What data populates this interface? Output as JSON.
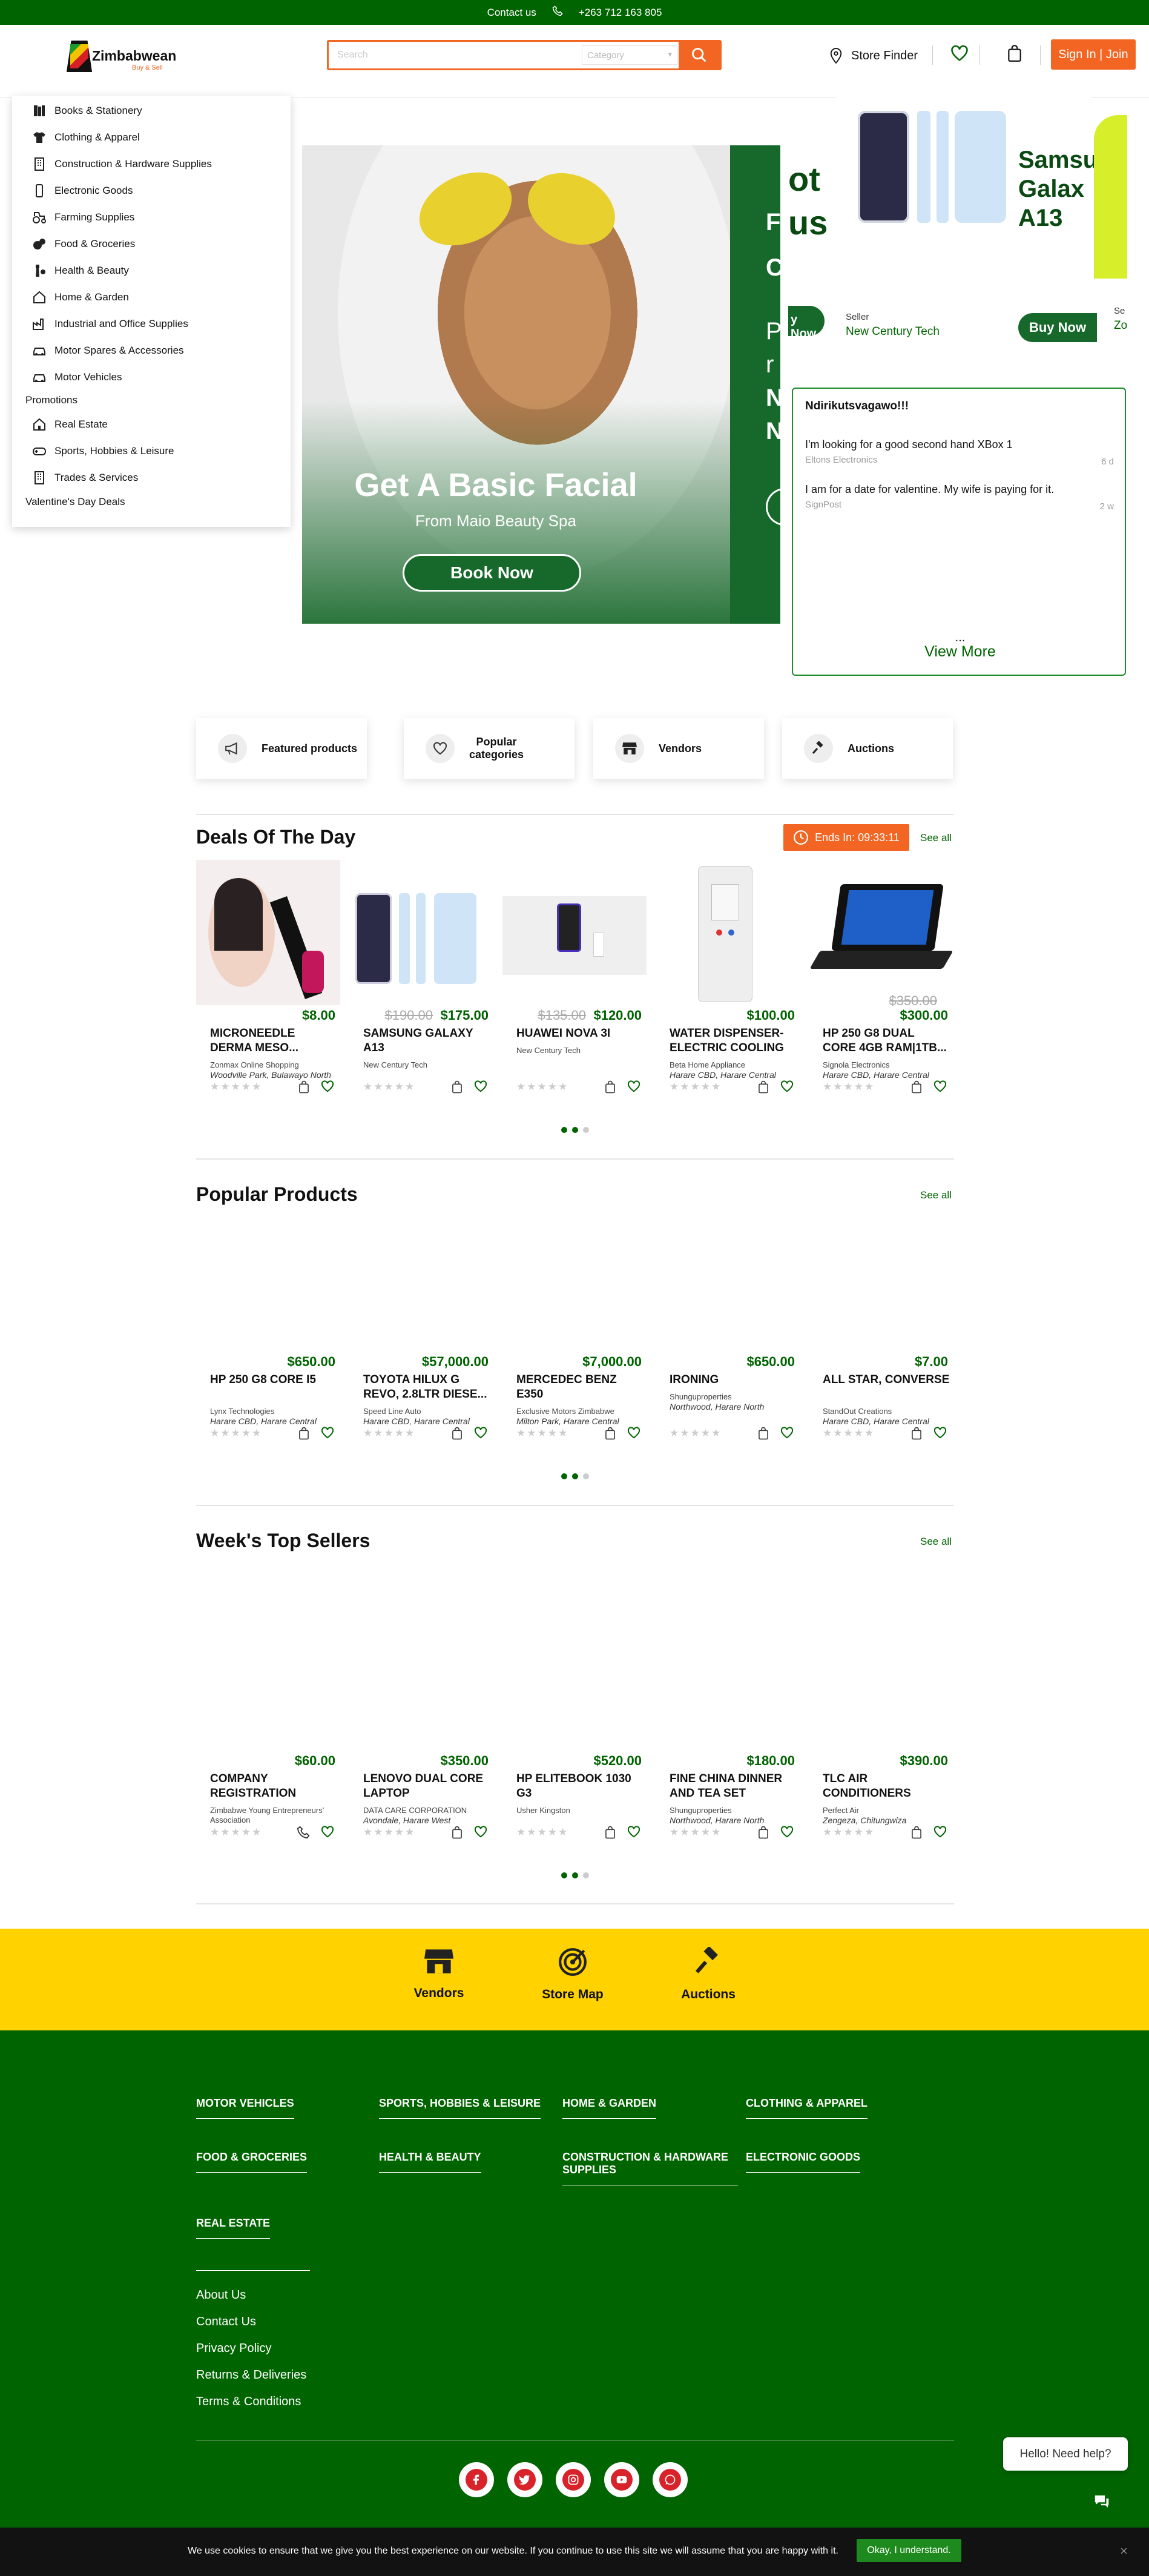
{
  "topbar": {
    "contact": "Contact us",
    "phone": "+263 712 163 805"
  },
  "header": {
    "logo_name": "Zimbabwean",
    "logo_sub": "Buy & Sell",
    "search_placeholder": "Search",
    "category_placeholder": "Category",
    "store_finder": "Store Finder",
    "signin": "Sign In | Join"
  },
  "categories": [
    {
      "label": "Books & Stationery",
      "icon": "books-icon"
    },
    {
      "label": "Clothing & Apparel",
      "icon": "shirt-icon"
    },
    {
      "label": "Construction & Hardware Supplies",
      "icon": "building-icon"
    },
    {
      "label": "Electronic Goods",
      "icon": "phone-icon"
    },
    {
      "label": "Farming Supplies",
      "icon": "tractor-icon"
    },
    {
      "label": "Food & Groceries",
      "icon": "food-icon"
    },
    {
      "label": "Health & Beauty",
      "icon": "beauty-icon"
    },
    {
      "label": "Home & Garden",
      "icon": "home-icon"
    },
    {
      "label": "Industrial and Office Supplies",
      "icon": "factory-icon"
    },
    {
      "label": "Motor Spares & Accessories",
      "icon": "car-icon"
    },
    {
      "label": "Motor Vehicles",
      "icon": "car-icon"
    }
  ],
  "categories_extra": [
    {
      "label": "Real Estate",
      "icon": "house-icon"
    },
    {
      "label": "Sports, Hobbies & Leisure",
      "icon": "gamepad-icon"
    },
    {
      "label": "Trades & Services",
      "icon": "building-icon"
    }
  ],
  "promotions_label": "Promotions",
  "valentines_label": "Valentine's Day Deals",
  "hero": {
    "title": "Get A Basic Facial",
    "subtitle": "From Maio Beauty Spa",
    "button": "Book Now",
    "peek_lines": [
      "F",
      "C",
      "P",
      "r",
      "N",
      "N"
    ]
  },
  "promo": {
    "left_peek": "ot\nus",
    "left_buy": "y Now",
    "model": "Samsu\nGalax\nA13",
    "seller_label": "Seller",
    "seller_name": "New Century Tech",
    "buy": "Buy Now",
    "right_peek_seller": "Se",
    "right_peek_name": "Zo"
  },
  "posts": {
    "user": "Ndirikutsvagawo!!!",
    "items": [
      {
        "text": "I'm looking for a good second hand XBox 1",
        "source": "Eltons Electronics",
        "age": "6 d"
      },
      {
        "text": "I am for a date for valentine. My wife is paying for it.",
        "source": "SignPost",
        "age": "2 w"
      }
    ],
    "ellipsis": "...",
    "view_more": "View More"
  },
  "features": [
    {
      "label": "Featured products",
      "icon": "megaphone-icon"
    },
    {
      "label": "Popular\ncategories",
      "icon": "heart-icon"
    },
    {
      "label": "Vendors",
      "icon": "store-icon"
    },
    {
      "label": "Auctions",
      "icon": "gavel-icon"
    }
  ],
  "deals": {
    "title": "Deals Of The Day",
    "timer": "Ends In: 09:33:11",
    "see_all": "See all",
    "products": [
      {
        "price": "$8.00",
        "old": "",
        "name": "MICRONEEDLE DERMA MESO...",
        "seller": "Zonmax Online Shopping",
        "loc": "Woodville Park, Bulawayo North"
      },
      {
        "price": "$175.00",
        "old": "$190.00",
        "name": "SAMSUNG GALAXY A13",
        "seller": "New Century Tech",
        "loc": ""
      },
      {
        "price": "$120.00",
        "old": "$135.00",
        "name": "HUAWEI NOVA 3I",
        "seller": "New Century Tech",
        "loc": ""
      },
      {
        "price": "$100.00",
        "old": "",
        "name": "WATER DISPENSER-ELECTRIC COOLING",
        "seller": "Beta Home Appliance",
        "loc": "Harare CBD, Harare Central"
      },
      {
        "price": "$300.00",
        "old": "$350.00",
        "name": "HP 250 G8 DUAL CORE 4GB RAM|1TB...",
        "seller": "Signola Electronics",
        "loc": "Harare CBD, Harare Central"
      }
    ]
  },
  "popular": {
    "title": "Popular Products",
    "see_all": "See all",
    "products": [
      {
        "price": "$650.00",
        "name": "HP 250 G8 CORE I5",
        "seller": "Lynx Technologies",
        "loc": "Harare CBD, Harare Central"
      },
      {
        "price": "$57,000.00",
        "name": "TOYOTA HILUX G REVO, 2.8LTR DIESE...",
        "seller": "Speed Line Auto",
        "loc": "Harare CBD, Harare Central"
      },
      {
        "price": "$7,000.00",
        "name": "MERCEDEC BENZ E350",
        "seller": "Exclusive Motors Zimbabwe",
        "loc": "Milton Park, Harare Central"
      },
      {
        "price": "$650.00",
        "name": "IRONING",
        "seller": "Shunguproperties",
        "loc": "Northwood, Harare North"
      },
      {
        "price": "$7.00",
        "name": "ALL STAR, CONVERSE",
        "seller": "StandOut Creations",
        "loc": "Harare CBD, Harare Central"
      }
    ]
  },
  "topsellers": {
    "title": "Week's Top Sellers",
    "see_all": "See all",
    "products": [
      {
        "price": "$60.00",
        "name": "COMPANY REGISTRATION",
        "seller": "Zimbabwe Young Entrepreneurs' Association",
        "loc": ""
      },
      {
        "price": "$350.00",
        "name": "LENOVO DUAL CORE LAPTOP",
        "seller": "DATA CARE CORPORATION",
        "loc": "Avondale, Harare West"
      },
      {
        "price": "$520.00",
        "name": "HP ELITEBOOK 1030 G3",
        "seller": "Usher Kingston",
        "loc": ""
      },
      {
        "price": "$180.00",
        "name": "FINE CHINA DINNER AND TEA SET",
        "seller": "Shunguproperties",
        "loc": "Northwood, Harare North"
      },
      {
        "price": "$390.00",
        "name": "TLC AIR CONDITIONERS",
        "seller": "Perfect Air",
        "loc": "Zengeza, Chitungwiza"
      }
    ]
  },
  "yellowbar": [
    {
      "label": "Vendors",
      "icon": "store-icon"
    },
    {
      "label": "Store Map",
      "icon": "radar-icon"
    },
    {
      "label": "Auctions",
      "icon": "gavel-icon"
    }
  ],
  "footer_cats": [
    "MOTOR VEHICLES",
    "SPORTS, HOBBIES & LEISURE",
    "HOME & GARDEN",
    "CLOTHING & APPAREL",
    "FOOD & GROCERIES",
    "HEALTH & BEAUTY",
    "CONSTRUCTION & HARDWARE SUPPLIES",
    "ELECTRONIC GOODS",
    "REAL ESTATE"
  ],
  "footer_links": [
    "About Us",
    "Contact Us",
    "Privacy Policy",
    "Returns & Deliveries",
    "Terms & Conditions"
  ],
  "social": [
    "facebook-icon",
    "twitter-icon",
    "instagram-icon",
    "youtube-icon",
    "whatsapp-icon"
  ],
  "help": "Hello! Need help?",
  "cookie": {
    "text": "We use cookies to ensure that we give you the best experience on our website. If you continue to use this site we will assume that you are happy with it.",
    "button": "Okay, I understand."
  },
  "colors": {
    "green": "#006400",
    "orange": "#F26522",
    "yellow": "#FFD200"
  }
}
